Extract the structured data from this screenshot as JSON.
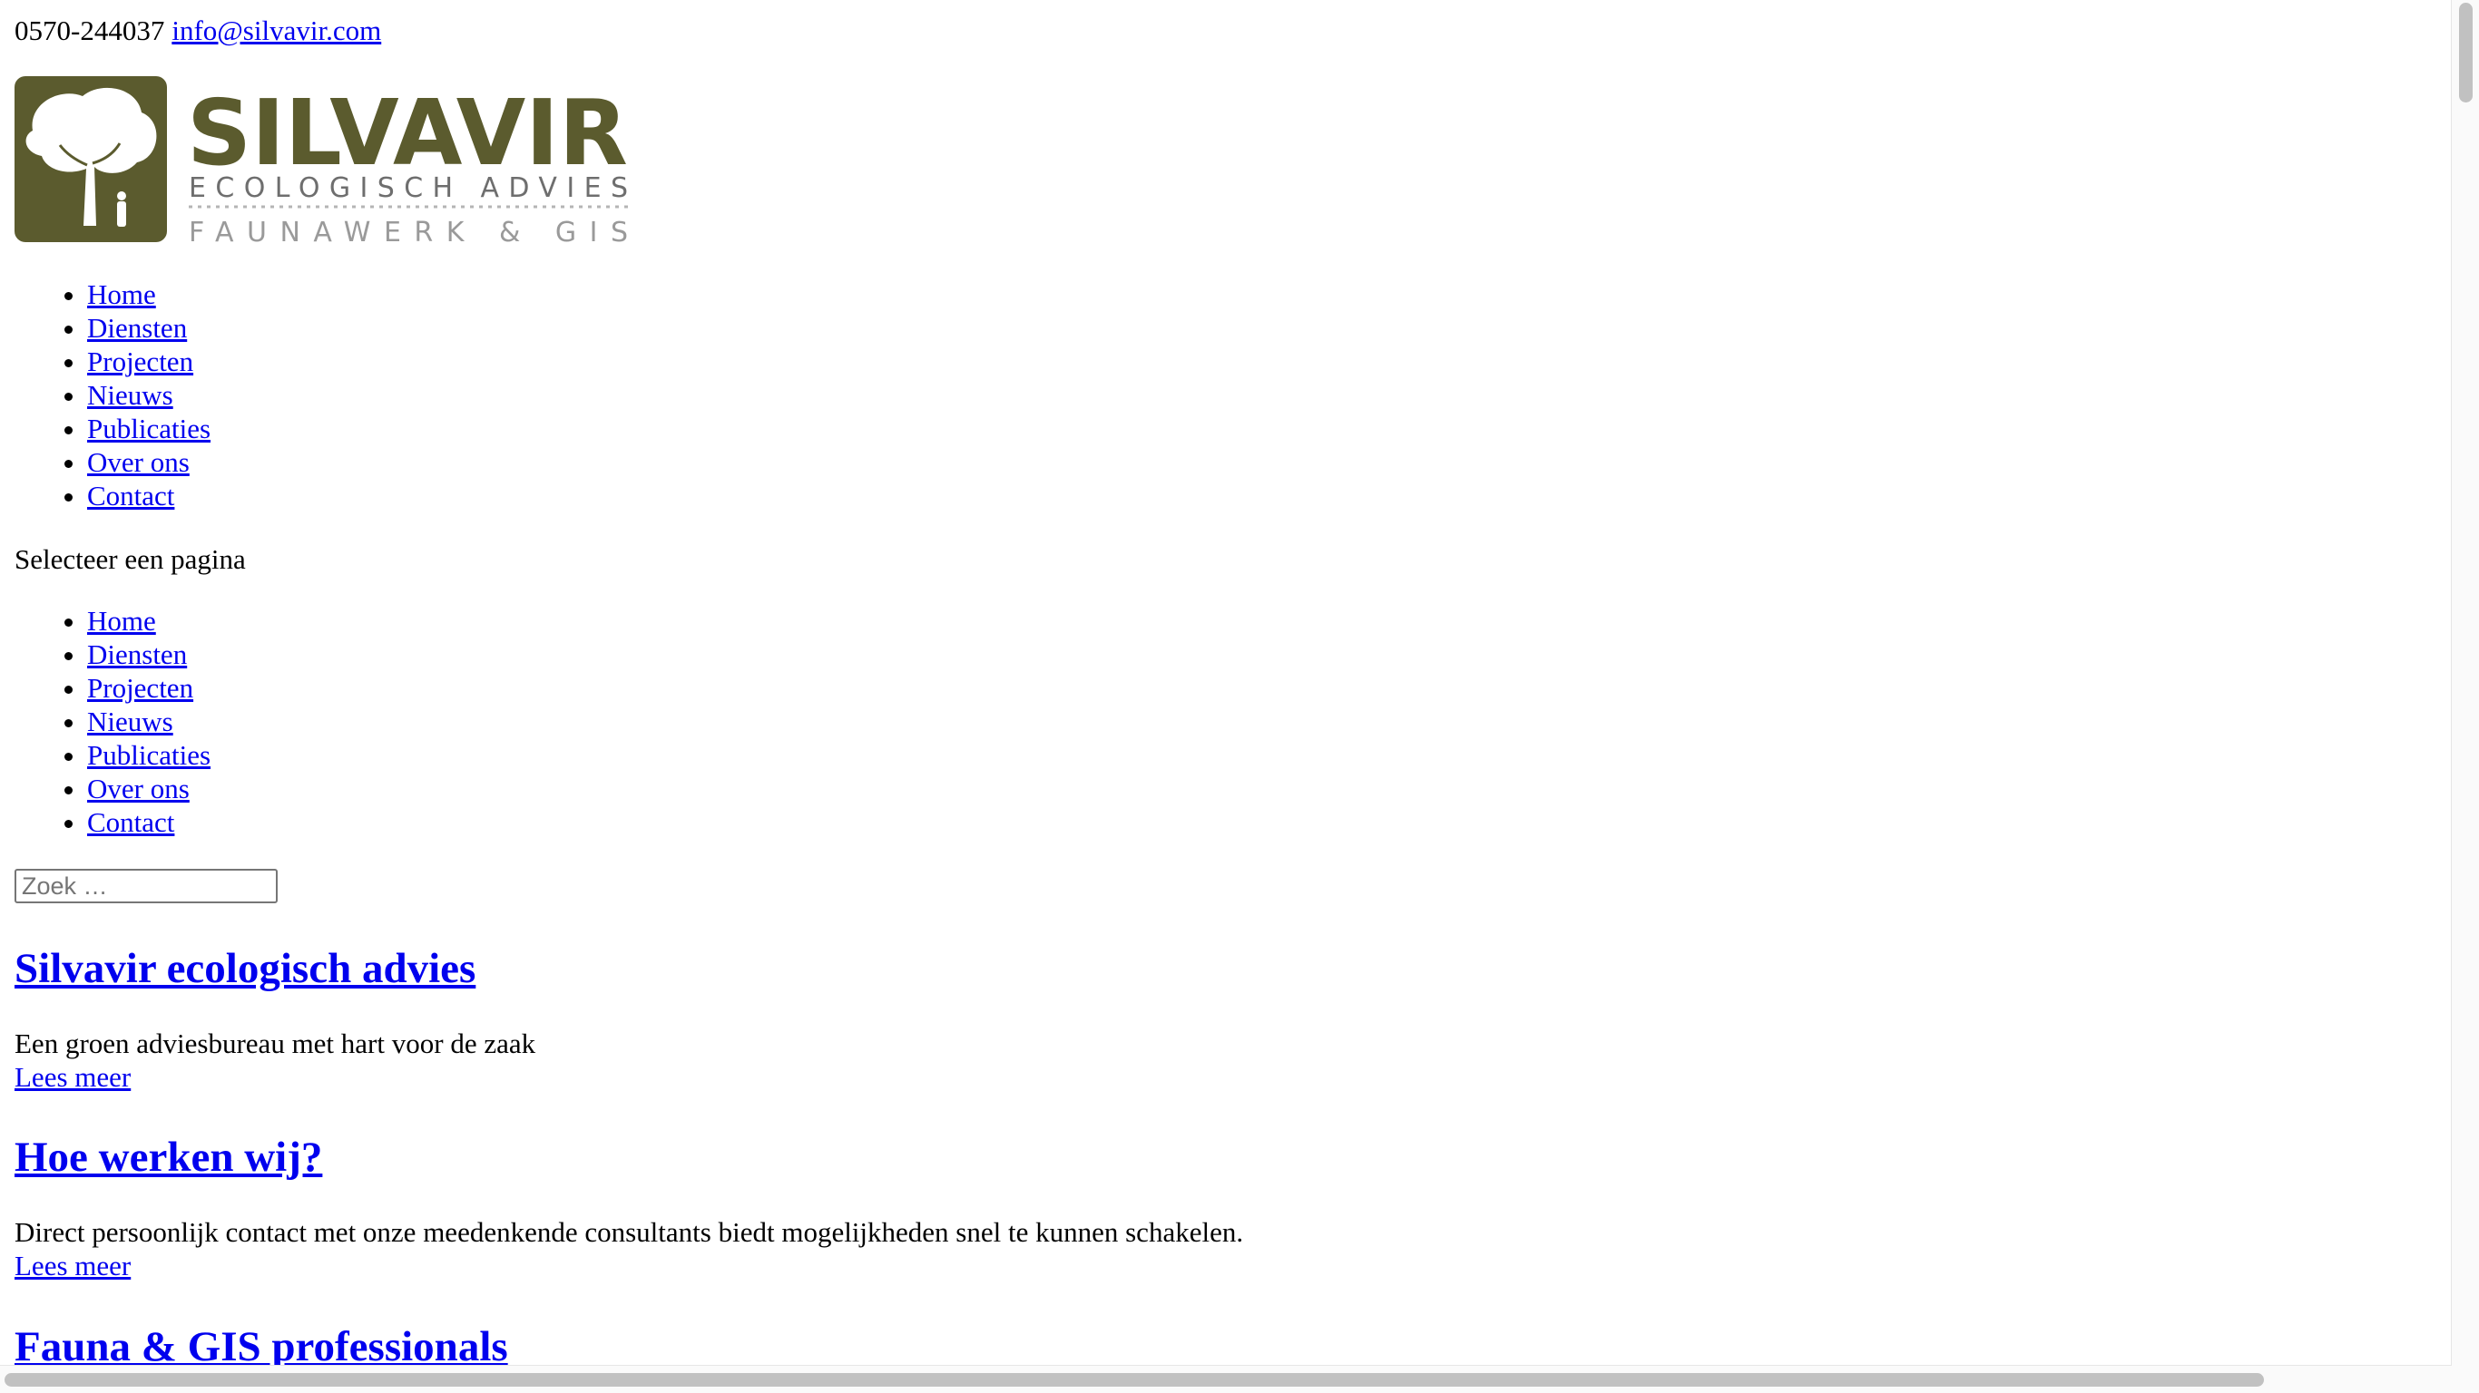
{
  "topbar": {
    "phone": "0570-244037",
    "email": "info@silvavir.com"
  },
  "logo": {
    "brand": "SILVAVIR",
    "line1": "ECOLOGISCH ADVIES",
    "line2": "FAUNAWERK & GIS",
    "color": "#5b5b2e"
  },
  "nav_primary": {
    "items": [
      "Home",
      "Diensten",
      "Projecten",
      "Nieuws",
      "Publicaties",
      "Over ons",
      "Contact"
    ]
  },
  "mobile_nav": {
    "label": "Selecteer een pagina",
    "items": [
      "Home",
      "Diensten",
      "Projecten",
      "Nieuws",
      "Publicaties",
      "Over ons",
      "Contact"
    ]
  },
  "search": {
    "placeholder": "Zoek …",
    "value": ""
  },
  "sections": [
    {
      "title": "Silvavir ecologisch advies",
      "text": "Een groen adviesbureau met hart voor de zaak",
      "link": "Lees meer"
    },
    {
      "title": "Hoe werken wij?",
      "text": "Direct persoonlijk contact met onze meedenkende consultants biedt mogelijkheden snel te kunnen schakelen.",
      "link": "Lees meer"
    },
    {
      "title": "Fauna & GIS professionals"
    }
  ]
}
